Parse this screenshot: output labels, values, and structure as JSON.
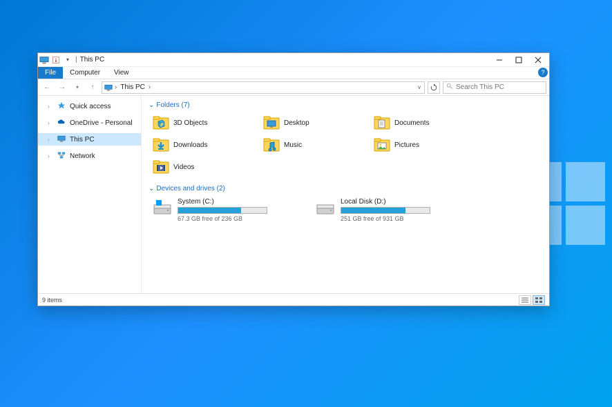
{
  "title": {
    "text": "This PC",
    "separator": "|"
  },
  "ribbon": {
    "file": "File",
    "tabs": [
      "Computer",
      "View"
    ]
  },
  "nav": {
    "breadcrumb": "This PC",
    "dropdown_chevron": "v"
  },
  "search": {
    "placeholder": "Search This PC",
    "icon": "search-icon"
  },
  "sidebar": {
    "items": [
      {
        "label": "Quick access",
        "icon": "star-icon",
        "selected": false,
        "expandable": true
      },
      {
        "label": "OneDrive - Personal",
        "icon": "cloud-icon",
        "selected": false,
        "expandable": true
      },
      {
        "label": "This PC",
        "icon": "pc-icon",
        "selected": true,
        "expandable": true
      },
      {
        "label": "Network",
        "icon": "network-icon",
        "selected": false,
        "expandable": true
      }
    ]
  },
  "groups": {
    "folders": {
      "header": "Folders (7)",
      "expanded": true
    },
    "drives": {
      "header": "Devices and drives (2)",
      "expanded": true
    }
  },
  "folders": [
    {
      "label": "3D Objects",
      "icon": "3d-icon"
    },
    {
      "label": "Desktop",
      "icon": "desktop-icon"
    },
    {
      "label": "Documents",
      "icon": "documents-icon"
    },
    {
      "label": "Downloads",
      "icon": "downloads-icon"
    },
    {
      "label": "Music",
      "icon": "music-icon"
    },
    {
      "label": "Pictures",
      "icon": "pictures-icon"
    },
    {
      "label": "Videos",
      "icon": "videos-icon"
    }
  ],
  "drives": [
    {
      "name": "System (C:)",
      "free_text": "67.3 GB free of 236 GB",
      "used_pct": 71
    },
    {
      "name": "Local Disk (D:)",
      "free_text": "251 GB free of 931 GB",
      "used_pct": 73
    }
  ],
  "statusbar": {
    "items": "9 items"
  },
  "colors": {
    "accent": "#1979ca",
    "select": "#cce8ff",
    "progress": "#26a0da"
  }
}
